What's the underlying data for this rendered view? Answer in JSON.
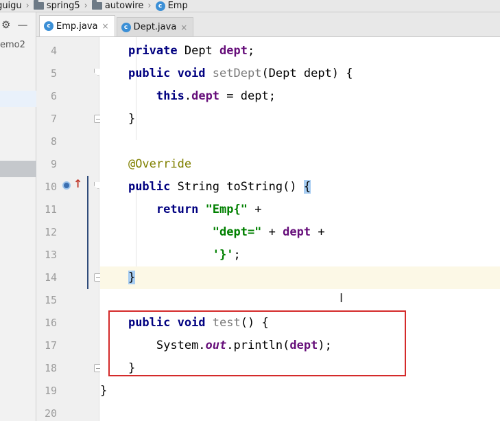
{
  "breadcrumb": [
    {
      "label": "atguigu",
      "icon": "folder-icon"
    },
    {
      "label": "spring5",
      "icon": "folder-icon"
    },
    {
      "label": "autowire",
      "icon": "folder-icon"
    },
    {
      "label": "Emp",
      "icon": "class-icon"
    }
  ],
  "left_panel": {
    "settings_glyph": "⚙",
    "collapse_glyph": "—",
    "project_label": "emo2"
  },
  "tabs": [
    {
      "label": "Emp.java",
      "icon_letter": "c",
      "close": "×",
      "active": true
    },
    {
      "label": "Dept.java",
      "icon_letter": "c",
      "close": "×",
      "active": false
    }
  ],
  "line_numbers": [
    "4",
    "5",
    "6",
    "7",
    "8",
    "9",
    "10",
    "11",
    "12",
    "13",
    "14",
    "15",
    "16",
    "17",
    "18",
    "19",
    "20"
  ],
  "code": {
    "l4": {
      "kw": "private",
      "type": " Dept ",
      "field": "dept",
      "end": ";"
    },
    "l5": {
      "kw": "public void",
      "name": " setDept",
      "params": "(Dept dept) {"
    },
    "l6": {
      "kw": "this",
      "dot": ".",
      "field": "dept",
      "rest": " = dept;"
    },
    "l7": {
      "text": "}"
    },
    "l9": {
      "anno": "@Override"
    },
    "l10": {
      "kw": "public",
      "sig": " String toString() ",
      "brace": "{"
    },
    "l11": {
      "kw": "return",
      "sp": " ",
      "str": "\"Emp{\"",
      "rest": " +"
    },
    "l12": {
      "str": "\"dept=\"",
      "mid": " + ",
      "field": "dept",
      "rest": " +"
    },
    "l13": {
      "str": "'}'",
      "rest": ";"
    },
    "l14": {
      "brace": "}"
    },
    "l16": {
      "kw": "public void",
      "name": " test",
      "rest": "() {"
    },
    "l17": {
      "pre": "System.",
      "static": "out",
      "mid": ".println(",
      "field": "dept",
      "rest": ");"
    },
    "l18": {
      "text": "}"
    },
    "l19": {
      "text": "}"
    }
  },
  "colors": {
    "keyword": "#000080",
    "field": "#660e7a",
    "string": "#008000",
    "annotation": "#808000",
    "highlight_box": "#d42a2a"
  }
}
